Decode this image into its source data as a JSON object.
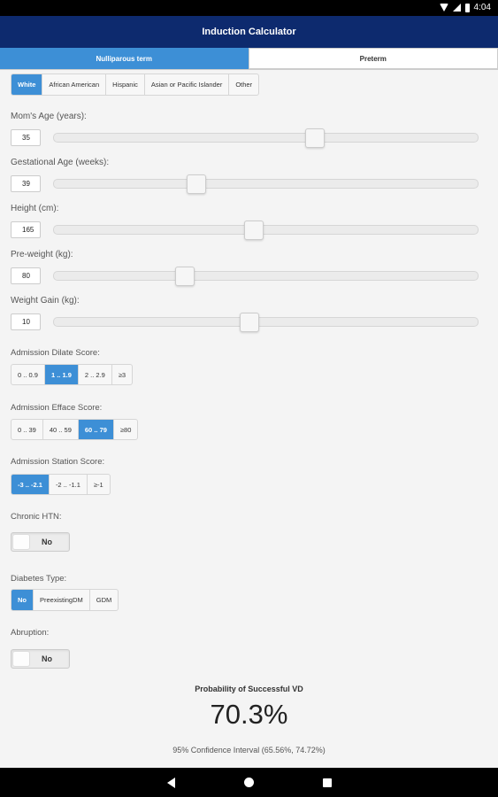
{
  "status_bar": {
    "time": "4:04"
  },
  "app": {
    "title": "Induction Calculator"
  },
  "tabs": [
    {
      "label": "Nulliparous term",
      "active": true
    },
    {
      "label": "Preterm",
      "active": false
    }
  ],
  "race": {
    "options": [
      "White",
      "African American",
      "Hispanic",
      "Asian or Pacific Islander",
      "Other"
    ],
    "selected": "White"
  },
  "sliders": [
    {
      "label": "Mom's Age (years):",
      "value": "35",
      "level": 0.62
    },
    {
      "label": "Gestational Age (weeks):",
      "value": "39",
      "level": 0.33
    },
    {
      "label": "Height (cm):",
      "value": "165",
      "level": 0.47
    },
    {
      "label": "Pre-weight (kg):",
      "value": "80",
      "level": 0.3
    },
    {
      "label": "Weight Gain (kg):",
      "value": "10",
      "level": 0.46
    }
  ],
  "dilate": {
    "label": "Admission Dilate Score:",
    "options": [
      "0 .. 0.9",
      "1 .. 1.9",
      "2 .. 2.9",
      "≥3"
    ],
    "selected": "1 .. 1.9"
  },
  "efface": {
    "label": "Admission Efface Score:",
    "options": [
      "0 .. 39",
      "40 .. 59",
      "60 .. 79",
      "≥80"
    ],
    "selected": "60 .. 79"
  },
  "station": {
    "label": "Admission Station Score:",
    "options": [
      "-3 .. -2.1",
      "-2 .. -1.1",
      "≥-1"
    ],
    "selected": "-3 .. -2.1"
  },
  "chronic_htn": {
    "label": "Chronic HTN:",
    "value": "No"
  },
  "diabetes": {
    "label": "Diabetes Type:",
    "options": [
      "No",
      "PreexistingDM",
      "GDM"
    ],
    "selected": "No"
  },
  "abruption": {
    "label": "Abruption:",
    "value": "No"
  },
  "result": {
    "title": "Probability of Successful VD",
    "value": "70.3%",
    "ci": "95% Confidence Interval (65.56%, 74.72%)"
  }
}
